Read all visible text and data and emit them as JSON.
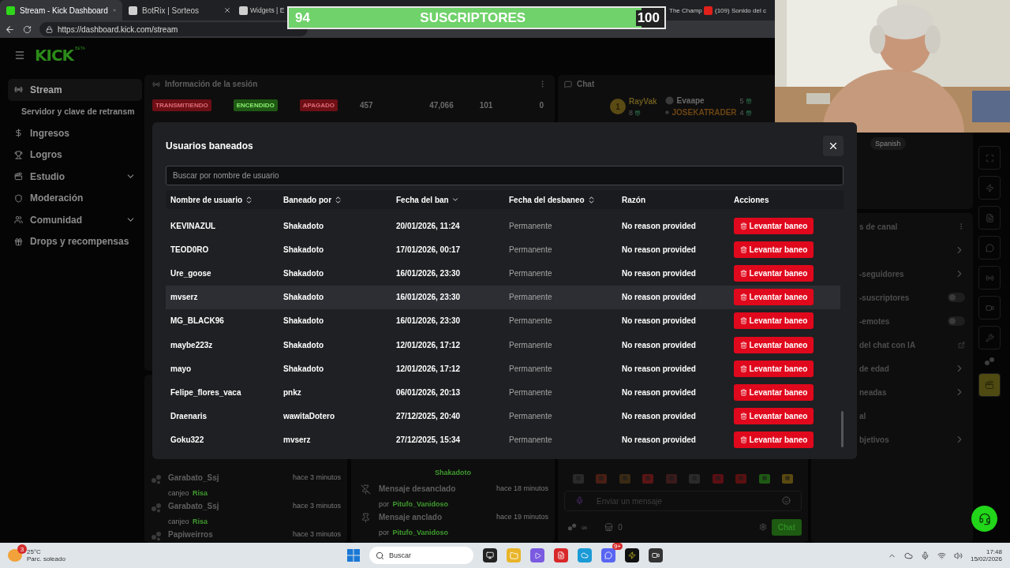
{
  "browser": {
    "tabs": [
      {
        "title": "Stream - Kick Dashboard",
        "selected": true,
        "kind": "kick"
      },
      {
        "title": "BotRix | Sorteos",
        "selected": false,
        "kind": "site"
      },
      {
        "title": "Widgets | E",
        "selected": false,
        "kind": "site"
      },
      {
        "title": "The Champ",
        "selected": false,
        "kind": "partial"
      },
      {
        "title": "(109) Sonido del c",
        "selected": false,
        "kind": "youtube"
      }
    ],
    "url": "https://dashboard.kick.com/stream"
  },
  "sub_goal": {
    "current": "94",
    "label": "SUSCRIPTORES",
    "target": "100",
    "level": 0.94
  },
  "sidebar": {
    "logo": "KICK",
    "logo_tag": "BETA",
    "items": [
      {
        "label": "Stream",
        "kind": "item",
        "selected": true
      },
      {
        "label": "Servidor y clave de retransm",
        "kind": "subitem",
        "selected": false
      },
      {
        "label": "Ingresos",
        "kind": "item",
        "selected": false
      },
      {
        "label": "Logros",
        "kind": "item",
        "selected": false
      },
      {
        "label": "Estudio",
        "kind": "group",
        "selected": false
      },
      {
        "label": "Moderación",
        "kind": "item",
        "selected": false
      },
      {
        "label": "Comunidad",
        "kind": "group",
        "selected": false
      },
      {
        "label": "Drops y recompensas",
        "kind": "item",
        "selected": false
      }
    ]
  },
  "session": {
    "title": "Información de la sesión",
    "badges": [
      {
        "label": "TRANSMITIENDO",
        "color": "#6e0f16"
      },
      {
        "label": "ENCENDIDO",
        "color": "#1f5a14"
      },
      {
        "label": "APAGADO",
        "color": "#6e0f16"
      }
    ],
    "stats": [
      "457",
      "47,066",
      "101",
      "0"
    ]
  },
  "rewards": [
    {
      "user": "Garabato_Ssj",
      "action": "canjeo",
      "reward": "Risa",
      "time": "hace 3 minutos"
    },
    {
      "user": "Garabato_Ssj",
      "action": "canjeo",
      "reward": "Risa",
      "time": "hace 3 minutos"
    },
    {
      "user": "Papiweirros",
      "time": "hace 3 minutos"
    }
  ],
  "mod_log": {
    "cut_user": "Shakadoto",
    "entries": [
      {
        "kind": "unpin",
        "title": "Mensaje desanclado",
        "by": "por",
        "user": "Pitufo_Vanidoso",
        "time": "hace 18 minutos"
      },
      {
        "kind": "pin",
        "title": "Mensaje anclado",
        "by": "por",
        "user": "Pitufo_Vanidoso",
        "time": "hace 19 minutos"
      }
    ]
  },
  "chat": {
    "title": "Chat",
    "top_chatters": [
      {
        "name": "RayVak",
        "count": "8",
        "rank": "1",
        "color": "#6b5a1e"
      },
      {
        "name": "Evaape",
        "count": "5",
        "color": "#6a6a6a"
      },
      {
        "name": "JOSEKATRADER",
        "count": "4",
        "color": "#6b4414"
      }
    ],
    "input": {
      "placeholder": "Enviar un mensaje"
    },
    "infinity": "∞",
    "store_count": "0",
    "send": "Chat"
  },
  "stream_preview": {
    "language": "Spanish"
  },
  "channel_settings": [
    {
      "label": "s de canal",
      "kind": "menu"
    },
    {
      "kind": "link"
    },
    {
      "label": "-seguidores",
      "kind": "link"
    },
    {
      "label": "-suscriptores",
      "kind": "toggle",
      "on": false
    },
    {
      "label": "-emotes",
      "kind": "toggle",
      "on": false
    },
    {
      "label": "del chat con IA",
      "kind": "external"
    },
    {
      "label": "de edad",
      "kind": "link"
    },
    {
      "label": "neadas",
      "kind": "link"
    },
    {
      "label": "al",
      "kind": "plain"
    },
    {
      "label": "bjetivos",
      "kind": "link"
    }
  ],
  "modal": {
    "title": "Usuarios baneados",
    "search": {
      "placeholder": "Buscar por nombre de usuario"
    },
    "columns": [
      {
        "label": "Nombre de usuario",
        "kind": "sortable"
      },
      {
        "label": "Baneado por",
        "kind": "sortable"
      },
      {
        "label": "Fecha del ban",
        "kind": "sorted"
      },
      {
        "label": "Fecha del desbaneo",
        "kind": "sortable"
      },
      {
        "label": "Razón",
        "kind": "plain"
      },
      {
        "label": "Acciones",
        "kind": "plain"
      }
    ],
    "rows": [
      {
        "user": "KEVINAZUL",
        "by": "Shakadoto",
        "date": "20/01/2026, 11:24",
        "unban": "Permanente",
        "reason": "No reason provided",
        "action": "Levantar baneo",
        "highlighted": false
      },
      {
        "user": "TEOD0RO",
        "by": "Shakadoto",
        "date": "17/01/2026, 00:17",
        "unban": "Permanente",
        "reason": "No reason provided",
        "action": "Levantar baneo",
        "highlighted": false
      },
      {
        "user": "Ure_goose",
        "by": "Shakadoto",
        "date": "16/01/2026, 23:30",
        "unban": "Permanente",
        "reason": "No reason provided",
        "action": "Levantar baneo",
        "highlighted": false
      },
      {
        "user": "mvserz",
        "by": "Shakadoto",
        "date": "16/01/2026, 23:30",
        "unban": "Permanente",
        "reason": "No reason provided",
        "action": "Levantar baneo",
        "highlighted": true
      },
      {
        "user": "MG_BLACK96",
        "by": "Shakadoto",
        "date": "16/01/2026, 23:30",
        "unban": "Permanente",
        "reason": "No reason provided",
        "action": "Levantar baneo",
        "highlighted": false
      },
      {
        "user": "maybe223z",
        "by": "Shakadoto",
        "date": "12/01/2026, 17:12",
        "unban": "Permanente",
        "reason": "No reason provided",
        "action": "Levantar baneo",
        "highlighted": false
      },
      {
        "user": "mayo",
        "by": "Shakadoto",
        "date": "12/01/2026, 17:12",
        "unban": "Permanente",
        "reason": "No reason provided",
        "action": "Levantar baneo",
        "highlighted": false
      },
      {
        "user": "Felipe_flores_vaca",
        "by": "pnkz",
        "date": "06/01/2026, 20:13",
        "unban": "Permanente",
        "reason": "No reason provided",
        "action": "Levantar baneo",
        "highlighted": false
      },
      {
        "user": "Draenaris",
        "by": "wawitaDotero",
        "date": "27/12/2025, 20:40",
        "unban": "Permanente",
        "reason": "No reason provided",
        "action": "Levantar baneo",
        "highlighted": false
      },
      {
        "user": "Goku322",
        "by": "mvserz",
        "date": "27/12/2025, 15:34",
        "unban": "Permanente",
        "reason": "No reason provided",
        "action": "Levantar baneo",
        "highlighted": false
      }
    ]
  },
  "taskbar": {
    "weather": {
      "temp": "25°C",
      "desc": "Parc. soleado",
      "badge": "3"
    },
    "search": {
      "placeholder": "Buscar"
    },
    "discord_badge": "9+",
    "time": "17:48",
    "date": "15/02/2026"
  }
}
